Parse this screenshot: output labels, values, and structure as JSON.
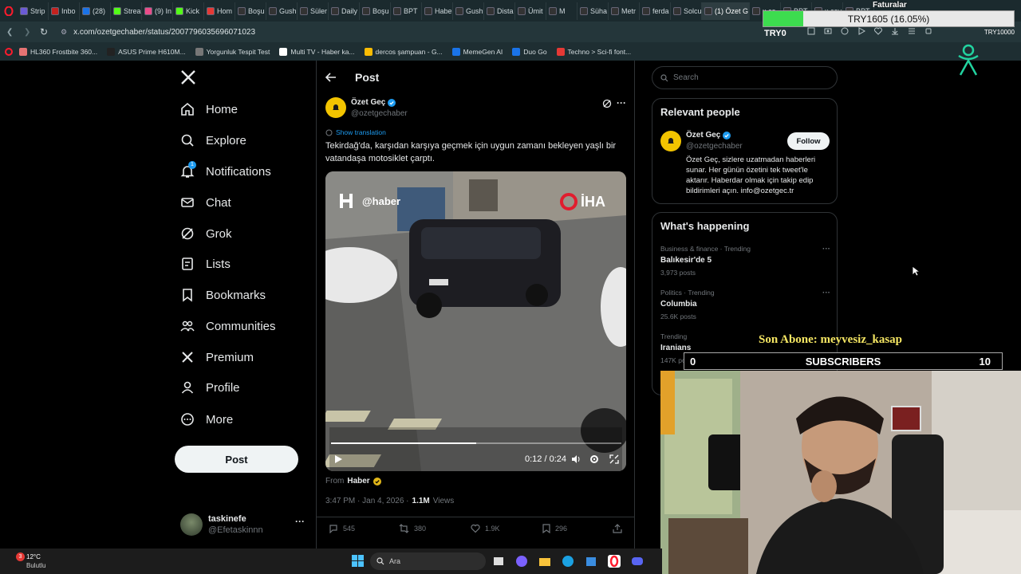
{
  "browser": {
    "tabs": [
      "Strip",
      "Inbo",
      "(28)",
      "Strea",
      "(9) In",
      "Kick",
      "Hom",
      "Boşu",
      "Gush",
      "Süler",
      "Daily",
      "Boşu",
      "BPT",
      "Habe",
      "Gush",
      "Dista",
      "Ümit",
      "M",
      "Süha",
      "Metr",
      "ferda",
      "Solcu",
      "(1) Özet G",
      "x.co",
      "BPT",
      "x.cov",
      "BPT"
    ],
    "url": "x.com/ozetgechaber/status/2007796035696071023",
    "bookmarks": [
      "HL360 Frostbite 360...",
      "ASUS Prime H610M...",
      "Yorgunluk Tespit Test",
      "Multi TV - Haber ka...",
      "dercos şampuan - G...",
      "MemeGen AI",
      "Duo Go",
      "Techno > Sci-fi font..."
    ]
  },
  "overlay": {
    "goal_title": "Faturalar",
    "goal_text": "TRY1605 (16.05%)",
    "goal_left": "TRY0",
    "goal_right": "TRY10000",
    "goal_progress": 0.1605,
    "last_sub": "Son Abone: meyvesiz_kasap",
    "sub_left": "0",
    "sub_label": "SUBSCRIBERS",
    "sub_right": "10"
  },
  "nav": {
    "items": [
      "Home",
      "Explore",
      "Notifications",
      "Chat",
      "Grok",
      "Lists",
      "Bookmarks",
      "Communities",
      "Premium",
      "Profile",
      "More"
    ],
    "notif_badge": "1",
    "post_button": "Post",
    "account_name": "taskinefe",
    "account_handle": "@Efetaskinnn",
    "more_dots": "···"
  },
  "header": {
    "title": "Post"
  },
  "tweet": {
    "author_name": "Özet Geç",
    "author_handle": "@ozetgechaber",
    "show_translation": "Show translation",
    "text": "Tekirdağ'da, karşıdan karşıya geçmek için uygun zamanı bekleyen yaşlı bir vatandaşa motosiklet çarptı.",
    "watermark_left": "@haber",
    "watermark_right": "İHA",
    "video_time": "0:12 / 0:24",
    "video_progress": 0.5,
    "from_label": "From",
    "from_source": "Haber",
    "timestamp": "3:47 PM · Jan 4, 2026 ·",
    "views_count": "1.1M",
    "views_label": "Views",
    "replies": "545",
    "reposts": "380",
    "likes": "1.9K",
    "bookmarks": "296"
  },
  "sidebar": {
    "search_placeholder": "Search",
    "relevant_title": "Relevant people",
    "person_name": "Özet Geç",
    "person_handle": "@ozetgechaber",
    "follow_label": "Follow",
    "person_bio": "Özet Geç, sizlere uzatmadan haberleri sunar. Her günün özetini tek tweet'le aktarır. Haberdar olmak için takip edip bildirimleri açın. info@ozetgec.tr",
    "happening_title": "What's happening",
    "trends": [
      {
        "context": "Business & finance · Trending",
        "topic": "Balıkesir'de 5",
        "count": "3,973 posts"
      },
      {
        "context": "Politics · Trending",
        "topic": "Columbia",
        "count": "25.6K posts"
      },
      {
        "context": "Trending",
        "topic": "Iranians",
        "count": "147K posts"
      }
    ]
  },
  "taskbar": {
    "weather_temp": "12°C",
    "weather_desc": "Bulutlu",
    "weather_badge": "3",
    "search_placeholder": "Ara"
  },
  "colors": {
    "accent": "#1d9bf0",
    "background": "#000000",
    "goal_bar": "#3ddc4f",
    "sub_text": "#f5e663"
  }
}
